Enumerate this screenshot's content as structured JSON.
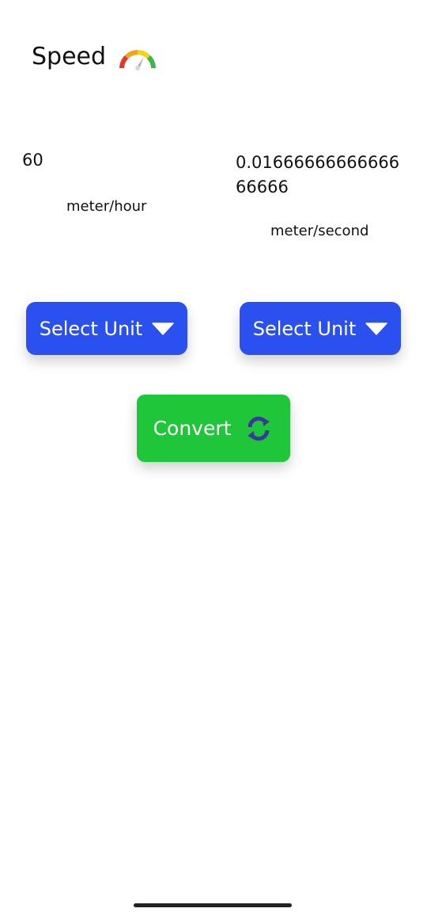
{
  "header": {
    "title": "Speed",
    "icon": "speedometer-icon"
  },
  "input": {
    "value": "60",
    "unit": "meter/hour"
  },
  "output": {
    "value": "0.0166666666666666666",
    "unit": "meter/second"
  },
  "buttons": {
    "select_from_label": "Select Unit",
    "select_to_label": "Select Unit",
    "convert_label": "Convert"
  },
  "colors": {
    "select_button": "#2a50f0",
    "convert_button": "#1fc63a",
    "refresh_icon": "#3a3a9a"
  }
}
